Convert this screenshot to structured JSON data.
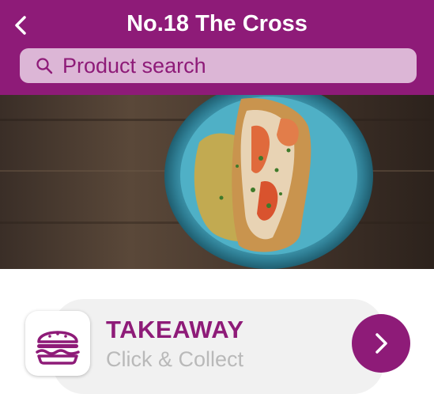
{
  "header": {
    "title": "No.18 The Cross",
    "back_icon": "chevron-left-icon",
    "background_color": "#8e1b78"
  },
  "search": {
    "placeholder": "Product search",
    "icon": "search-icon"
  },
  "hero": {
    "image": "food-photo"
  },
  "service_card": {
    "title": "TAKEAWAY",
    "subtitle": "Click & Collect",
    "icon": "burger-icon",
    "action_icon": "chevron-right-icon",
    "accent_color": "#8e1b78"
  }
}
